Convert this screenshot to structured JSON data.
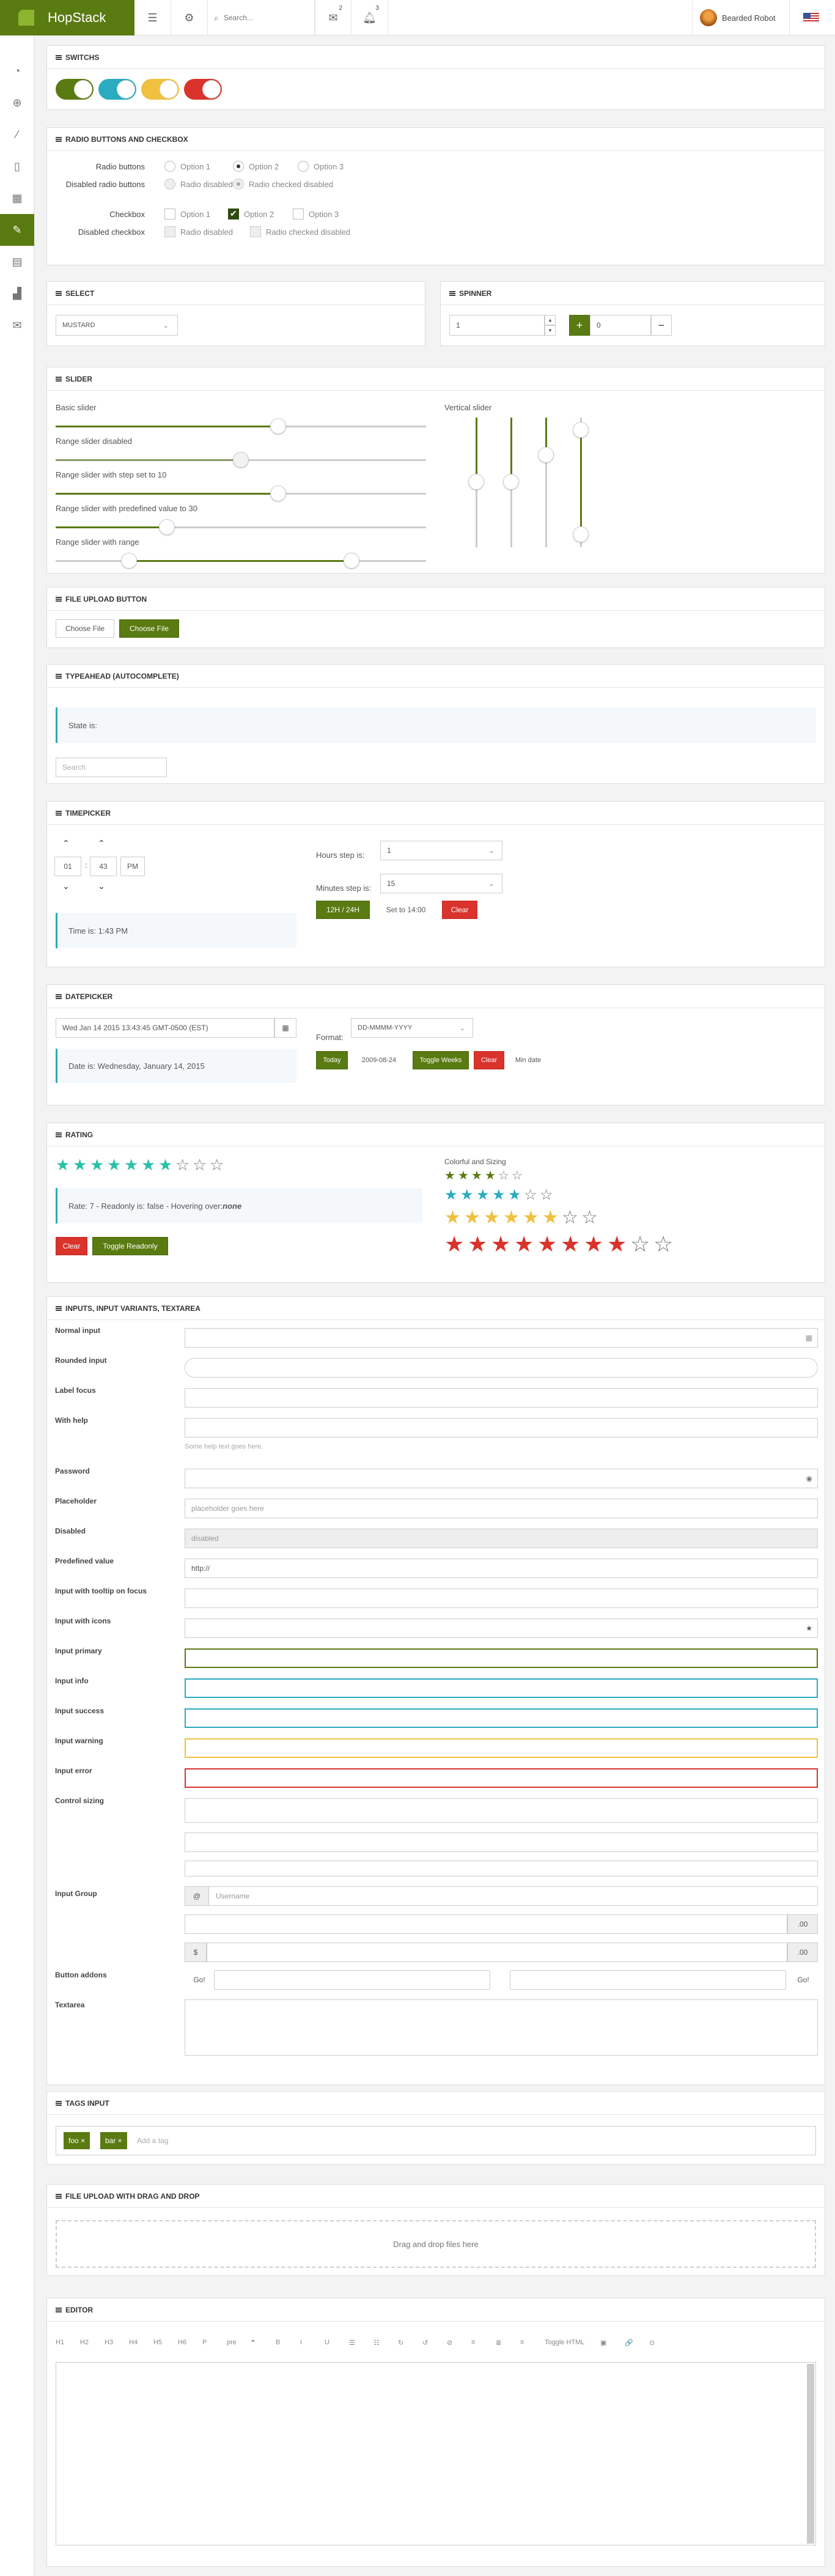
{
  "app": {
    "brand": "HopStack"
  },
  "topbar": {
    "search_placeholder": "Search...",
    "mail_count": "2",
    "bell_count": "3",
    "user_name": "Bearded Robot"
  },
  "sections": {
    "switches": "SWITCHS",
    "radios": "RADIO BUTTONS AND CHECKBOX",
    "select": "SELECT",
    "spinner": "SPINNER",
    "slider": "SLIDER",
    "fileupload": "FILE UPLOAD BUTTON",
    "typeahead": "TYPEAHEAD (AUTOCOMPLETE)",
    "timepicker": "TIMEPICKER",
    "datepicker": "DATEPICKER",
    "rating": "RATING",
    "inputs": "INPUTS, INPUT VARIANTS, TEXTAREA",
    "tags": "TAGS INPUT",
    "dropzone": "FILE UPLOAD WITH DRAG AND DROP",
    "editor": "EDITOR"
  },
  "switches": {
    "colors": [
      "#5a7a12",
      "#2aabc0",
      "#f0c040",
      "#d9332b"
    ]
  },
  "radios": {
    "radio_label": "Radio buttons",
    "disabled_radio_label": "Disabled radio buttons",
    "options": [
      "Option 1",
      "Option 2",
      "Option 3"
    ],
    "radio_disabled": "Radio disabled",
    "radio_checked_disabled": "Radio checked disabled",
    "checkbox_label": "Checkbox",
    "disabled_checkbox_label": "Disabled checkbox"
  },
  "select": {
    "value": "MUSTARD"
  },
  "spinner": {
    "value1": "1",
    "value2": "0",
    "plus": "+",
    "minus": "−"
  },
  "slider": {
    "basic": "Basic slider",
    "range_disabled": "Range slider disabled",
    "step": "Range slider with step set to 10",
    "predefined": "Range slider with predefined value to 30",
    "range": "Range slider with range",
    "vertical": "Vertical slider"
  },
  "fileupload": {
    "plain": "Choose File",
    "green": "Choose File"
  },
  "typeahead": {
    "state_label": "State is:",
    "search_placeholder": "Search"
  },
  "timepicker": {
    "hours": "01",
    "minutes": "43",
    "meridian": "PM",
    "time_label": "Time is: 1:43 PM",
    "hours_step_label": "Hours step is:",
    "hours_step": "1",
    "minutes_step_label": "Minutes step is:",
    "minutes_step": "15",
    "btn_12h": "12H / 24H",
    "btn_set": "Set to 14:00",
    "btn_clear": "Clear"
  },
  "datepicker": {
    "value": "Wed Jan 14 2015 13:43:45 GMT-0500 (EST)",
    "date_label": "Date is: Wednesday, January 14, 2015",
    "format_label": "Format:",
    "format_value": "DD-MMMM-YYYY",
    "btn_today": "Today",
    "btn_date": "2009-08-24",
    "btn_weeks": "Toggle Weeks",
    "btn_clear": "Clear",
    "btn_min": "Min date"
  },
  "rating": {
    "text_prefix": "Rate: 7 - Readonly is: false - Hovering over: ",
    "hover_value": "none",
    "btn_clear": "Clear",
    "btn_readonly": "Toggle Readonly",
    "colorful_label": "Colorful and Sizing",
    "main_value": 7,
    "main_max": 10,
    "rows": [
      {
        "value": 4,
        "max": 6,
        "color": "#5a7a12"
      },
      {
        "value": 5,
        "max": 7,
        "color": "#2aabc0"
      },
      {
        "value": 6,
        "max": 8,
        "color": "#f0c040"
      },
      {
        "value": 8,
        "max": 10,
        "color": "#d9332b"
      }
    ]
  },
  "inputs": {
    "normal": "Normal input",
    "rounded": "Rounded input",
    "label_focus": "Label focus",
    "with_help": "With help",
    "help_text": "Some help text goes here.",
    "password": "Password",
    "placeholder_label": "Placeholder",
    "placeholder_text": "placeholder goes here",
    "disabled_label": "Disabled",
    "disabled_value": "disabled",
    "predefined_label": "Predefined value",
    "predefined_value": "http://",
    "tooltip": "Input with tooltip on focus",
    "icons": "Input with icons",
    "primary": "Input primary",
    "info": "Input info",
    "success": "Input success",
    "warning": "Input warning",
    "error": "Input error",
    "sizing": "Control sizing",
    "group": "Input Group",
    "username": "Username",
    "at": "@",
    "cents": ".00",
    "dollar": "$",
    "addons": "Button addons",
    "go": "Go!",
    "textarea": "Textarea"
  },
  "tags": {
    "items": [
      "foo ×",
      "bar ×"
    ],
    "placeholder": "Add a tag"
  },
  "dropzone": {
    "text": "Drag and drop files here"
  },
  "editor": {
    "toolbar": [
      "H1",
      "H2",
      "H3",
      "H4",
      "H5",
      "H6",
      "P",
      "pre",
      "❞",
      "B",
      "I",
      "U",
      "☰",
      "☷",
      "↻",
      "↺",
      "⊘",
      "≡",
      "≣",
      "≡",
      "Toggle HTML",
      "▣",
      "🔗",
      "⊙"
    ]
  }
}
